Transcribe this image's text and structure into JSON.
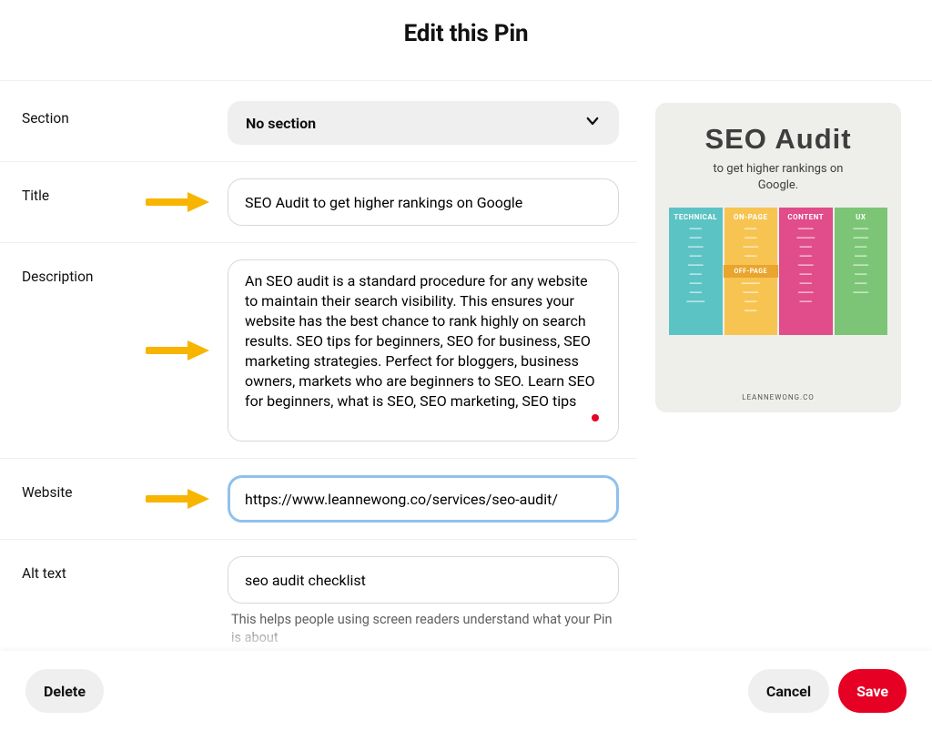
{
  "header": {
    "title": "Edit this Pin"
  },
  "fields": {
    "section": {
      "label": "Section",
      "selected": "No section"
    },
    "title": {
      "label": "Title",
      "value": "SEO Audit to get higher rankings on Google"
    },
    "description": {
      "label": "Description",
      "value": "An SEO audit is a standard procedure for any website to maintain their search visibility. This ensures your website has the best chance to rank highly on search results. SEO tips for beginners, SEO for business, SEO marketing strategies. Perfect for bloggers, business owners, markets who are beginners to SEO. Learn SEO for beginners, what is SEO, SEO marketing, SEO tips"
    },
    "website": {
      "label": "Website",
      "value": "https://www.leannewong.co/services/seo-audit/"
    },
    "alt_text": {
      "label": "Alt text",
      "value": "seo audit checklist",
      "helper": "This helps people using screen readers understand what your Pin is about"
    }
  },
  "footer": {
    "delete_label": "Delete",
    "cancel_label": "Cancel",
    "save_label": "Save"
  },
  "annotation_color": "#F7B500",
  "preview": {
    "title": "SEO Audit",
    "subtitle": "to get higher rankings on Google.",
    "brand": "LEANNEWONG.CO",
    "columns": {
      "technical": {
        "header": "TECHNICAL",
        "color": "#5CC3C4"
      },
      "on_page": {
        "header": "ON-PAGE",
        "color": "#F7C452",
        "off_page_header": "OFF-PAGE"
      },
      "content": {
        "header": "CONTENT",
        "color": "#E14C8A"
      },
      "ux": {
        "header": "UX",
        "color": "#7CC576"
      }
    }
  }
}
